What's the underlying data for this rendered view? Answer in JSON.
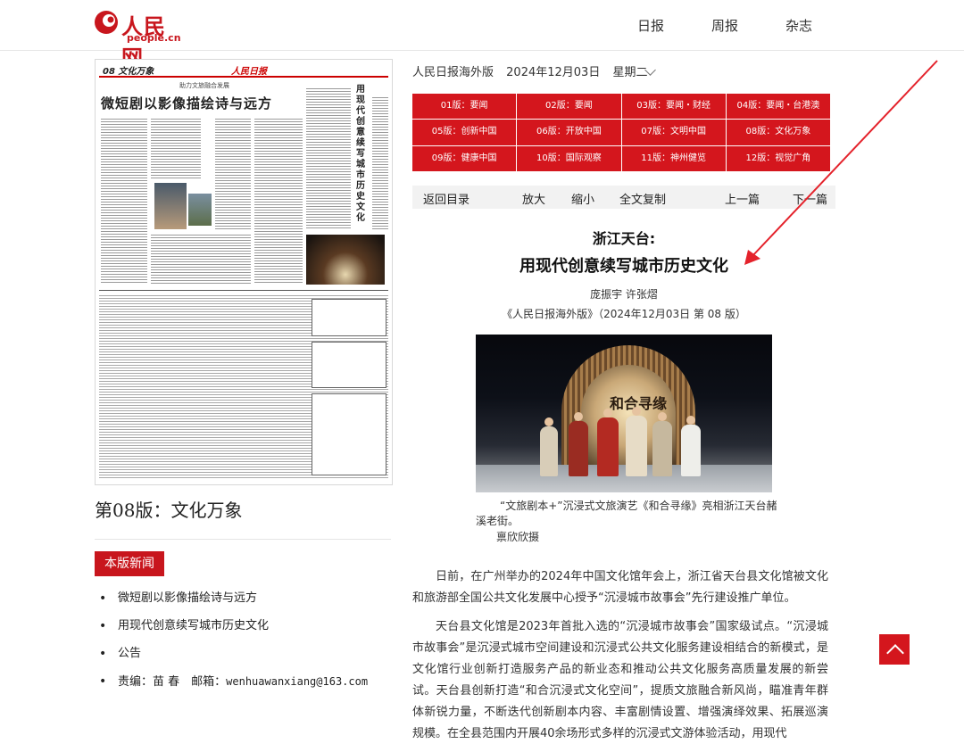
{
  "header": {
    "logo_cn": "人民网",
    "logo_en": "people.cn",
    "nav": [
      "日报",
      "周报",
      "杂志"
    ]
  },
  "paper": {
    "edition_no": "08",
    "edition_tag": "文化万象",
    "masthead": "人民日报",
    "subhead": "助力文旅融合发展",
    "headline": "微短剧以影像描绘诗与远方",
    "vertical_title": "用现代创意续写城市历史文化"
  },
  "sidebar": {
    "page_title": "第08版：文化万象",
    "section_tab": "本版新闻",
    "news": [
      "微短剧以影像描绘诗与远方",
      "用现代创意续写城市历史文化",
      "公告"
    ],
    "editor_label": "责编：苗 春　邮箱：",
    "editor_email": "wenhuawanxiang@163.com"
  },
  "edition_bar": {
    "publication": "人民日报海外版",
    "date": "2024年12月03日",
    "weekday": "星期二"
  },
  "editions": [
    "01版：要闻",
    "02版：要闻",
    "03版：要闻・财经",
    "04版：要闻・台港澳",
    "05版：创新中国",
    "06版：开放中国",
    "07版：文明中国",
    "08版：文化万象",
    "09版：健康中国",
    "10版：国际观察",
    "11版：神州健览",
    "12版：视觉广角"
  ],
  "toolbar": {
    "back": "返回目录",
    "zoom_in": "放大",
    "zoom_out": "缩小",
    "copy": "全文复制",
    "prev": "上一篇",
    "next": "下一篇"
  },
  "article": {
    "kicker": "浙江天台:",
    "title": "用现代创意续写城市历史文化",
    "authors": "庞振宇  许张熠",
    "source": "《人民日报海外版》（2024年12月03日   第  08  版）",
    "photo_text": "和合寻缘",
    "caption": "“文旅剧本+”沉浸式文旅演艺《和合寻缘》亮相浙江天台赭溪老街。",
    "credit": "禀欣欣摄",
    "paragraphs": [
      "日前，在广州举办的2024年中国文化馆年会上，浙江省天台县文化馆被文化和旅游部全国公共文化发展中心授予“沉浸城市故事会”先行建设推广单位。",
      "天台县文化馆是2023年首批入选的“沉浸城市故事会”国家级试点。“沉浸城市故事会”是沉浸式城市空间建设和沉浸式公共文化服务建设相结合的新模式，是文化馆行业创新打造服务产品的新业态和推动公共文化服务高质量发展的新尝试。天台县创新打造“和合沉浸式文化空间”，提质文旅融合新风尚，瞄准青年群体新锐力量，不断迭代创新剧本内容、丰富剧情设置、增强演绎效果、拓展巡演规模。在全县范围内开展40余场形式多样的沉浸式文游体验活动，用现代"
    ]
  },
  "colors": {
    "brand_red": "#c8161d",
    "edition_red": "#d4161d"
  },
  "icons": {
    "back_to_top": "chevron-up-icon",
    "date_dropdown": "chevron-down-icon"
  }
}
